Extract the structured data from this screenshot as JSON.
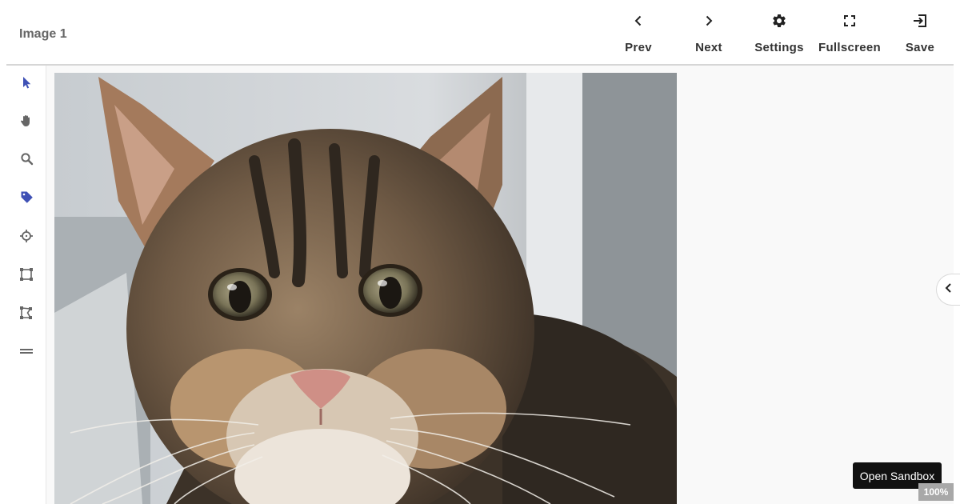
{
  "header": {
    "image_title": "Image 1"
  },
  "toolbar": {
    "prev": {
      "label": "Prev",
      "icon": "chevron-left-icon"
    },
    "next": {
      "label": "Next",
      "icon": "chevron-right-icon"
    },
    "settings": {
      "label": "Settings",
      "icon": "gear-icon"
    },
    "fullscreen": {
      "label": "Fullscreen",
      "icon": "fullscreen-icon"
    },
    "save": {
      "label": "Save",
      "icon": "save-exit-icon"
    }
  },
  "tools": [
    {
      "name": "select-tool",
      "icon": "cursor-arrow-icon",
      "active": true
    },
    {
      "name": "pan-tool",
      "icon": "hand-icon"
    },
    {
      "name": "zoom-tool",
      "icon": "magnifier-icon"
    },
    {
      "name": "tag-tool",
      "icon": "tag-icon"
    },
    {
      "name": "point-tool",
      "icon": "crosshair-icon"
    },
    {
      "name": "box-tool",
      "icon": "bounding-box-icon"
    },
    {
      "name": "polygon-tool",
      "icon": "polygon-icon"
    },
    {
      "name": "line-tool",
      "icon": "equals-icon"
    }
  ],
  "canvas": {
    "image_subject": "tabby kitten photo",
    "zoom": "100%"
  },
  "sidebar_toggle": {
    "icon": "chevron-left-icon"
  },
  "sandbox": {
    "label": "Open Sandbox"
  },
  "colors": {
    "accent": "#3f51b5",
    "icon": "#666666",
    "text": "#333333"
  }
}
